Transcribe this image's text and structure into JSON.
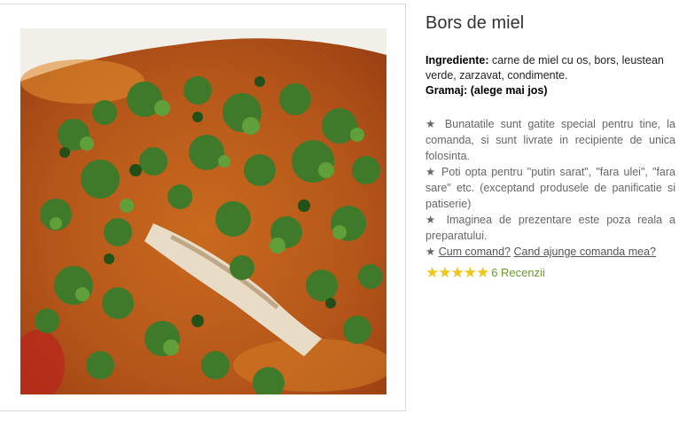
{
  "product": {
    "title": "Bors de miel",
    "ingredients_label": "Ingrediente:",
    "ingredients_text": " carne de miel cu os, bors, leustean verde, zarzavat, condimente.",
    "gramaj": "Gramaj: (alege mai jos)"
  },
  "notes": {
    "note1": "★ Bunatatile sunt gatite special pentru tine, la comanda, si sunt livrate in recipiente de unica folosinta.",
    "note2": "★ Poti opta pentru \"putin sarat\", \"fara ulei\", \"fara sare\" etc. (exceptand produsele de panificatie si patiserie)",
    "note3": "★ Imaginea de prezentare este poza reala a preparatului.",
    "note4_star": "★ ",
    "link_cum": "Cum comand?",
    "link_cand": "Cand ajunge comanda mea?"
  },
  "rating": {
    "stars": "★★★★★",
    "value": 5,
    "reviews_label": "6 Recenzii"
  },
  "colors": {
    "accent_stars": "#f0c419",
    "reviews_link": "#6a9a2c"
  },
  "image": {
    "subject": "soup-photo"
  }
}
